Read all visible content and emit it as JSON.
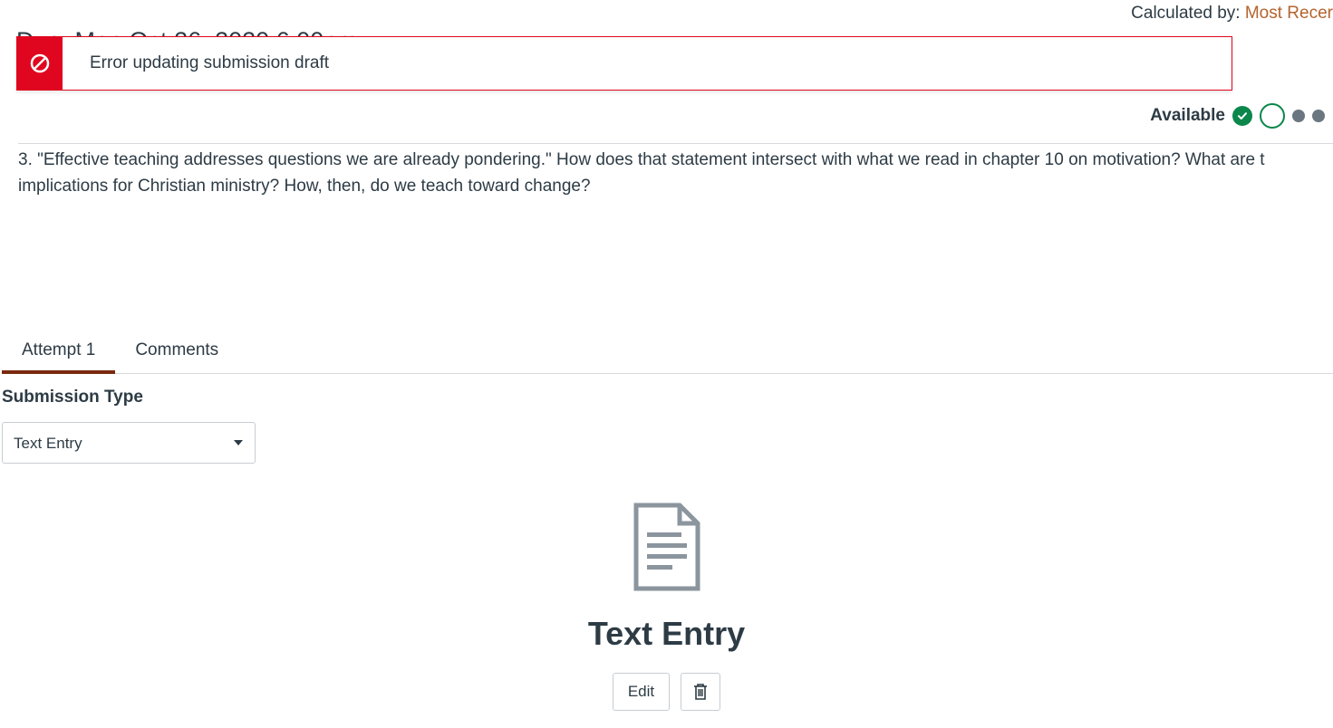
{
  "header": {
    "calculated_label": "Calculated by: ",
    "calculated_value": "Most Recer",
    "due_text": "Due: Mon Oct 26, 2020 6:00pm"
  },
  "alert": {
    "message": "Error updating submission draft"
  },
  "status": {
    "label": "Available"
  },
  "question": {
    "text": "3. \"Effective teaching addresses questions we are already pondering.\" How does that statement intersect with what we read in chapter 10 on motivation? What are t implications for Christian ministry? How, then, do we teach toward change?"
  },
  "tabs": {
    "attempt": "Attempt 1",
    "comments": "Comments"
  },
  "form": {
    "submission_type_label": "Submission Type",
    "submission_type_value": "Text Entry"
  },
  "entry": {
    "title": "Text Entry",
    "edit_label": "Edit"
  }
}
